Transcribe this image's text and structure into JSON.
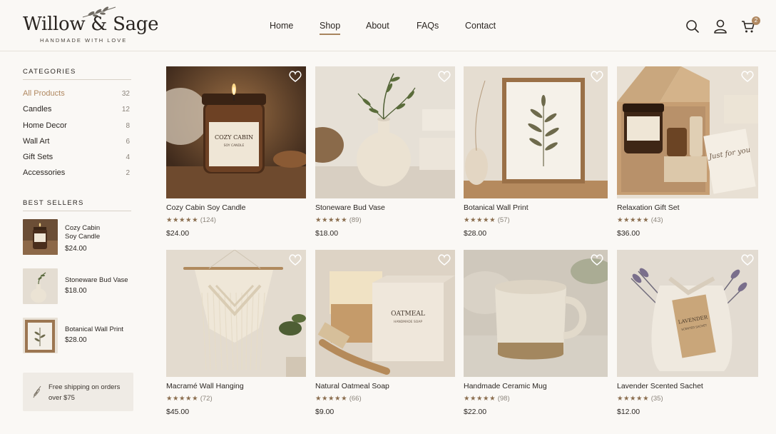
{
  "brand": {
    "name": "Willow & Sage",
    "tagline": "HANDMADE WITH LOVE"
  },
  "nav": [
    {
      "label": "Home",
      "active": false
    },
    {
      "label": "Shop",
      "active": true
    },
    {
      "label": "About",
      "active": false
    },
    {
      "label": "FAQs",
      "active": false
    },
    {
      "label": "Contact",
      "active": false
    }
  ],
  "header_icons": [
    "search-icon",
    "user-icon",
    "cart-icon"
  ],
  "cart_count": "2",
  "categories": {
    "heading": "CATEGORIES",
    "items": [
      {
        "label": "All Products",
        "count": "32",
        "active": true
      },
      {
        "label": "Candles",
        "count": "12"
      },
      {
        "label": "Home Decor",
        "count": "8"
      },
      {
        "label": "Wall Art",
        "count": "6"
      },
      {
        "label": "Gift Sets",
        "count": "4"
      },
      {
        "label": "Accessories",
        "count": "2"
      }
    ]
  },
  "best_sellers": {
    "heading": "BEST SELLERS",
    "items": [
      {
        "name": "Cozy Cabin Soy Candle",
        "line1": "Cozy Cabin",
        "line2": "Soy Candle",
        "price": "$24.00"
      },
      {
        "name": "Stoneware Bud Vase",
        "line1": "Stoneware Bud Vase",
        "line2": "",
        "price": "$18.00"
      },
      {
        "name": "Botanical Wall Print",
        "line1": "Botanical Wall Print",
        "line2": "",
        "price": "$28.00"
      }
    ]
  },
  "shipping_note": "Free shipping on orders over $75",
  "products": [
    {
      "name": "Cozy Cabin Soy Candle",
      "rating": 4.5,
      "stars": "★★★★★",
      "reviews": "(124)",
      "price": "$24.00",
      "label_text": "COZY CABIN",
      "label_sub": "SOY CANDLE"
    },
    {
      "name": "Stoneware Bud Vase",
      "rating": 4.5,
      "stars": "★★★★★",
      "reviews": "(89)",
      "price": "$18.00"
    },
    {
      "name": "Botanical Wall Print",
      "rating": 5,
      "stars": "★★★★★",
      "reviews": "(57)",
      "price": "$28.00"
    },
    {
      "name": "Relaxation Gift Set",
      "rating": 4.5,
      "stars": "★★★★★",
      "reviews": "(43)",
      "price": "$36.00",
      "card_text": "Just for you"
    },
    {
      "name": "Macramé Wall Hanging",
      "rating": 4.5,
      "stars": "★★★★★",
      "reviews": "(72)",
      "price": "$45.00"
    },
    {
      "name": "Natural Oatmeal Soap",
      "rating": 4.5,
      "stars": "★★★★★",
      "reviews": "(66)",
      "price": "$9.00",
      "label_text": "OATMEAL",
      "label_sub": "HANDMADE SOAP"
    },
    {
      "name": "Handmade Ceramic Mug",
      "rating": 5,
      "stars": "★★★★★",
      "reviews": "(98)",
      "price": "$22.00"
    },
    {
      "name": "Lavender Scented Sachet",
      "rating": 5,
      "stars": "★★★★★",
      "reviews": "(35)",
      "price": "$12.00",
      "label_text": "LAVENDER",
      "label_sub": "SCENTED SACHET"
    }
  ],
  "colors": {
    "accent": "#b08860",
    "background": "#faf8f5",
    "star": "#8a6d4e",
    "text": "#2b2622"
  }
}
